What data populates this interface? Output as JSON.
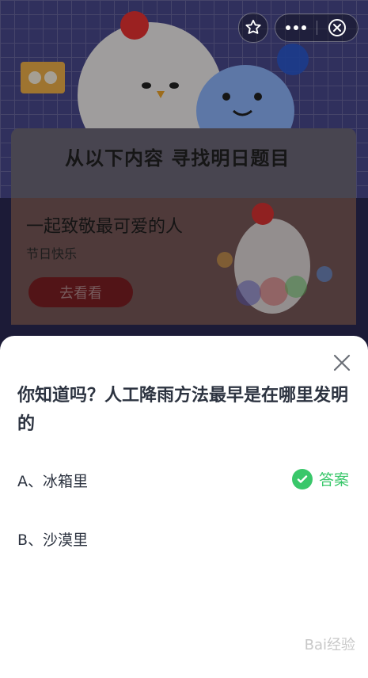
{
  "header": {
    "headline": "从以下内容  寻找明日题目",
    "icons": [
      "star-icon",
      "more-icon",
      "close-circle-icon"
    ]
  },
  "promo": {
    "title": "一起致敬最可爱的人",
    "subtitle": "节日快乐",
    "button_label": "去看看"
  },
  "quiz": {
    "question": "你知道吗？人工降雨方法最早是在哪里发明的",
    "options": [
      {
        "label": "A、冰箱里",
        "is_answer": true
      },
      {
        "label": "B、沙漠里",
        "is_answer": false
      }
    ],
    "answer_tag": "答案",
    "accent_color": "#39c76a"
  },
  "watermark": {
    "text": "Bai经验"
  }
}
